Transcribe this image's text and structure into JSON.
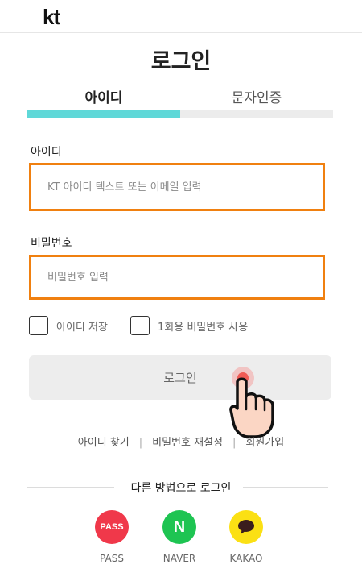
{
  "header": {
    "logo_text": "kt"
  },
  "page": {
    "title": "로그인"
  },
  "tabs": [
    {
      "label": "아이디",
      "active": true
    },
    {
      "label": "문자인증",
      "active": false
    }
  ],
  "id_field": {
    "label": "아이디",
    "placeholder": "KT 아이디 텍스트 또는 이메일 입력",
    "value": ""
  },
  "password_field": {
    "label": "비밀번호",
    "placeholder": "비밀번호 입력",
    "value": ""
  },
  "checkboxes": [
    {
      "label": "아이디 저장",
      "checked": false
    },
    {
      "label": "1회용 비밀번호 사용",
      "checked": false
    }
  ],
  "login_button": {
    "label": "로그인"
  },
  "links": [
    "아이디 찾기",
    "비밀번호 재설정",
    "회원가입"
  ],
  "alt_login": {
    "title": "다른 방법으로 로그인"
  },
  "social": [
    {
      "icon_text": "PASS",
      "label": "PASS",
      "color": "#f0384a"
    },
    {
      "icon_text": "N",
      "label": "NAVER",
      "color": "#1ec452"
    },
    {
      "icon_text": "",
      "label": "KAKAO",
      "color": "#fbe014"
    }
  ],
  "colors": {
    "accent": "#5fd8d8",
    "focus_border": "#f08010"
  }
}
